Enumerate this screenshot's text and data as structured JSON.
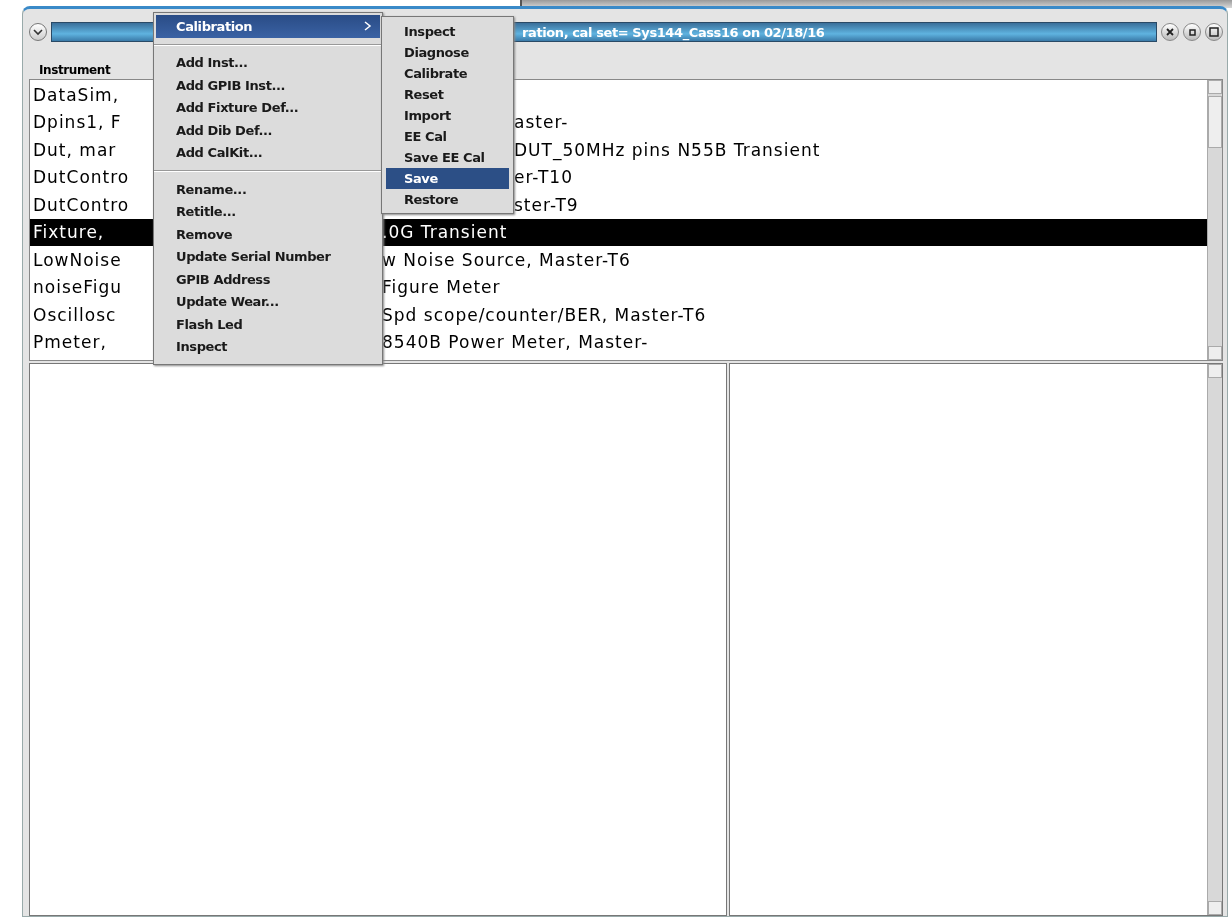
{
  "window": {
    "title": "ration,  cal set= Sys144_Cass16 on 02/18/16"
  },
  "menu_bar": [
    {
      "label": "Instrument",
      "selected": false
    }
  ],
  "list": {
    "rows": [
      {
        "left": "DataSim,",
        "right": "",
        "kind": "behind-submenu",
        "selected": false
      },
      {
        "left": "Dpins1,  F",
        "right": "aster-",
        "kind": "behind-submenu",
        "selected": false
      },
      {
        "left": "Dut,  mar",
        "right": "DUT_50MHz pins N55B Transient",
        "kind": "behind-submenu",
        "selected": false
      },
      {
        "left": "DutContro",
        "right": "er-T10",
        "kind": "behind-submenu",
        "selected": false
      },
      {
        "left": "DutContro",
        "right": "ster-T9",
        "kind": "behind-submenu",
        "selected": false
      },
      {
        "left": "Fixture,",
        "right": ".0G Transient",
        "kind": "behind-menu",
        "selected": true
      },
      {
        "left": "LowNoise",
        "right": "w Noise Source, Master-T6",
        "kind": "behind-menu",
        "selected": false
      },
      {
        "left": "noiseFigu",
        "right": "Figure Meter",
        "kind": "behind-menu",
        "selected": false
      },
      {
        "left": "Oscillosc",
        "right": "Spd scope/counter/BER, Master-T6",
        "kind": "behind-menu",
        "selected": false
      },
      {
        "left": "Pmeter,",
        "right": "8540B Power Meter, Master-",
        "kind": "behind-menu",
        "selected": false
      }
    ]
  },
  "context_menu": {
    "items": [
      {
        "kind": "submenu",
        "label": "Calibration",
        "selected": true
      },
      {
        "kind": "separator"
      },
      {
        "kind": "item",
        "label": "Add Inst...",
        "selected": false
      },
      {
        "kind": "item",
        "label": "Add GPIB Inst...",
        "selected": false
      },
      {
        "kind": "item",
        "label": "Add Fixture Def...",
        "selected": false
      },
      {
        "kind": "item",
        "label": "Add Dib Def...",
        "selected": false
      },
      {
        "kind": "item",
        "label": "Add CalKit...",
        "selected": false
      },
      {
        "kind": "separator"
      },
      {
        "kind": "item",
        "label": "Rename...",
        "selected": false
      },
      {
        "kind": "item",
        "label": "Retitle...",
        "selected": false
      },
      {
        "kind": "item",
        "label": "Remove",
        "selected": false
      },
      {
        "kind": "item",
        "label": "Update Serial Number",
        "selected": false
      },
      {
        "kind": "item",
        "label": "GPIB Address",
        "selected": false
      },
      {
        "kind": "item",
        "label": "Update Wear...",
        "selected": false
      },
      {
        "kind": "item",
        "label": "Flash Led",
        "selected": false
      },
      {
        "kind": "item",
        "label": "Inspect",
        "selected": false
      }
    ]
  },
  "submenu": {
    "items": [
      {
        "label": "Inspect",
        "selected": false
      },
      {
        "label": "Diagnose",
        "selected": false
      },
      {
        "label": "Calibrate",
        "selected": false
      },
      {
        "label": "Reset",
        "selected": false
      },
      {
        "label": "Import",
        "selected": false
      },
      {
        "label": "EE Cal",
        "selected": false
      },
      {
        "label": "Save EE Cal",
        "selected": false
      },
      {
        "label": "Save",
        "selected": true
      },
      {
        "label": "Restore",
        "selected": false
      }
    ]
  }
}
